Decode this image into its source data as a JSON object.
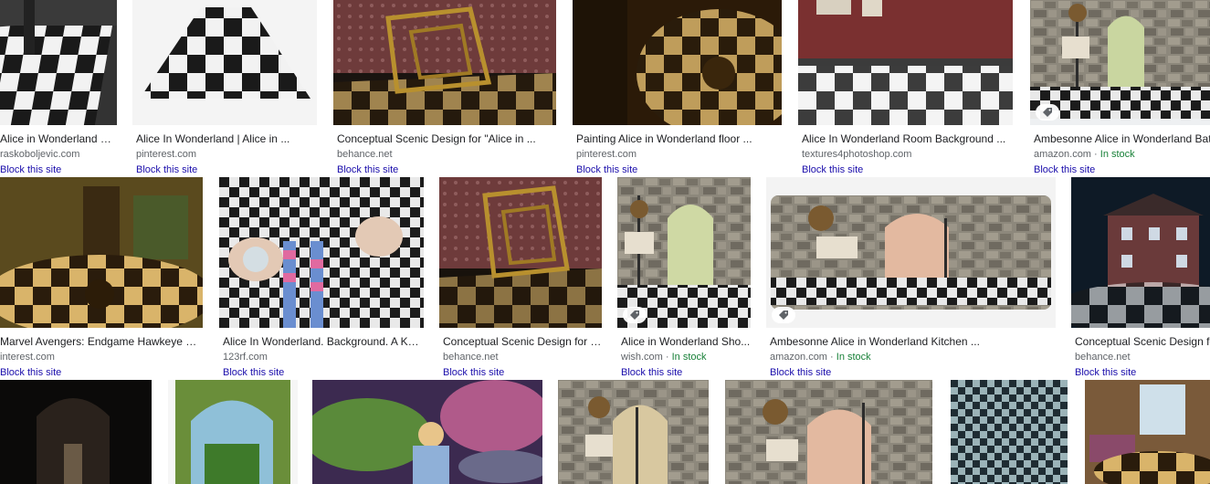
{
  "results": [
    {
      "title": "Alice in Wonderland – D...",
      "source": "raskoboljevic.com",
      "stock": "",
      "block": "Block this site"
    },
    {
      "title": "Alice In Wonderland | Alice in ...",
      "source": "pinterest.com",
      "stock": "",
      "block": "Block this site"
    },
    {
      "title": "Conceptual Scenic Design for \"Alice in ...",
      "source": "behance.net",
      "stock": "",
      "block": "Block this site"
    },
    {
      "title": "Painting Alice in Wonderland floor ...",
      "source": "pinterest.com",
      "stock": "",
      "block": "Block this site"
    },
    {
      "title": "Alice In Wonderland Room Background ...",
      "source": "textures4photoshop.com",
      "stock": "",
      "block": "Block this site"
    },
    {
      "title": "Ambesonne Alice in Wonderland Bath ...",
      "source": "amazon.com",
      "stock": "In stock",
      "block": "Block this site"
    },
    {
      "title": "Marvel Avengers: Endgame Hawkeye Funk...",
      "source": "interest.com",
      "stock": "",
      "block": "Block this site"
    },
    {
      "title": "Alice In Wonderland. Background. A Key ...",
      "source": "123rf.com",
      "stock": "",
      "block": "Block this site"
    },
    {
      "title": "Conceptual Scenic Design for \"...",
      "source": "behance.net",
      "stock": "",
      "block": "Block this site"
    },
    {
      "title": "Alice in Wonderland Sho...",
      "source": "wish.com",
      "stock": "In stock",
      "block": "Block this site"
    },
    {
      "title": "Ambesonne Alice in Wonderland Kitchen ...",
      "source": "amazon.com",
      "stock": "In stock",
      "block": "Block this site"
    },
    {
      "title": "Conceptual Scenic Design for ...",
      "source": "behance.net",
      "stock": "",
      "block": "Block this site"
    }
  ],
  "separator": " · ",
  "icons": {
    "shopping_tag": "tag-icon"
  },
  "colors": {
    "title": "#202124",
    "source": "#5f6368",
    "stock": "#188038",
    "block_link": "#1a0dab"
  }
}
